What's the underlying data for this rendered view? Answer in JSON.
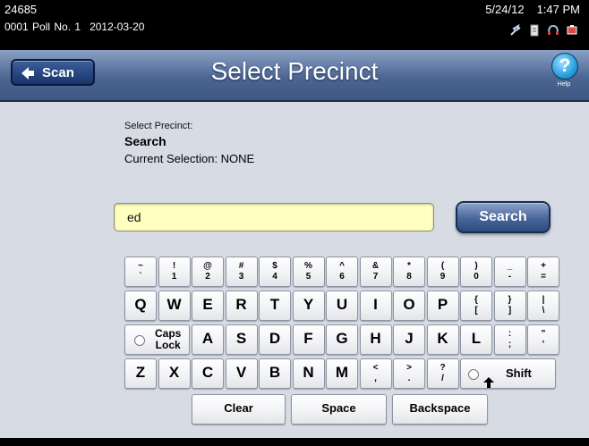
{
  "status": {
    "device_id": "24685",
    "poll_number": "0001 Poll No. 1",
    "poll_date": "2012-03-20",
    "date": "5/24/12",
    "time": "1:47 PM",
    "icons": [
      "network-icon",
      "document-icon",
      "headset-icon",
      "battery-icon"
    ]
  },
  "header": {
    "back_label": "Scan",
    "title": "Select Precinct",
    "help_label": "Help"
  },
  "main": {
    "instruction": "Select Precinct:",
    "mode": "Search",
    "current_selection": "Current Selection: NONE",
    "search_value": "ed",
    "search_button_label": "Search"
  },
  "keyboard": {
    "number_row": [
      {
        "top": "~",
        "bottom": "`"
      },
      {
        "top": "!",
        "bottom": "1"
      },
      {
        "top": "@",
        "bottom": "2"
      },
      {
        "top": "#",
        "bottom": "3"
      },
      {
        "top": "$",
        "bottom": "4"
      },
      {
        "top": "%",
        "bottom": "5"
      },
      {
        "top": "^",
        "bottom": "6"
      },
      {
        "top": "&",
        "bottom": "7"
      },
      {
        "top": "*",
        "bottom": "8"
      },
      {
        "top": "(",
        "bottom": "9"
      },
      {
        "top": ")",
        "bottom": "0"
      },
      {
        "top": "_",
        "bottom": "-"
      },
      {
        "top": "+",
        "bottom": "="
      }
    ],
    "row_q": [
      "Q",
      "W",
      "E",
      "R",
      "T",
      "Y",
      "U",
      "I",
      "O",
      "P"
    ],
    "row_q_symbols": [
      {
        "top": "{",
        "bottom": "["
      },
      {
        "top": "}",
        "bottom": "]"
      },
      {
        "top": "|",
        "bottom": "\\"
      }
    ],
    "caps_lock_label_1": "Caps",
    "caps_lock_label_2": "Lock",
    "row_a": [
      "A",
      "S",
      "D",
      "F",
      "G",
      "H",
      "J",
      "K",
      "L"
    ],
    "row_a_symbols": [
      {
        "top": ":",
        "bottom": ";"
      },
      {
        "top": "\"",
        "bottom": "'"
      }
    ],
    "row_z": [
      "Z",
      "X",
      "C",
      "V",
      "B",
      "N",
      "M"
    ],
    "row_z_symbols": [
      {
        "top": "<",
        "bottom": ","
      },
      {
        "top": ">",
        "bottom": "."
      },
      {
        "top": "?",
        "bottom": "/"
      }
    ],
    "shift_label": "Shift",
    "clear_label": "Clear",
    "space_label": "Space",
    "backspace_label": "Backspace"
  },
  "colors": {
    "title_bar": "#4c6694",
    "input_background": "#ffffc0",
    "help_icon": "#2a9fe0",
    "status_bar": "#000000"
  }
}
